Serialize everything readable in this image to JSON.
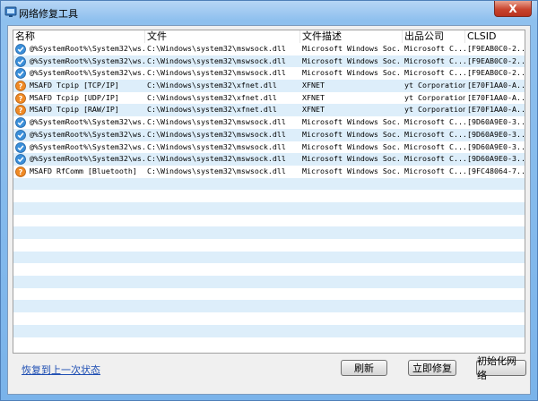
{
  "window": {
    "title": "网络修复工具",
    "close_label": "X"
  },
  "columns": [
    "名称",
    "文件",
    "文件描述",
    "出品公司",
    "CLSID"
  ],
  "rows": [
    {
      "icon": "check",
      "name": "@%SystemRoot%\\System32\\ws...",
      "file": "C:\\Windows\\system32\\mswsock.dll",
      "desc": "Microsoft Windows Soc...",
      "company": "Microsoft C...",
      "clsid": "[F9EAB0C0-2..."
    },
    {
      "icon": "check",
      "name": "@%SystemRoot%\\System32\\ws...",
      "file": "C:\\Windows\\system32\\mswsock.dll",
      "desc": "Microsoft Windows Soc...",
      "company": "Microsoft C...",
      "clsid": "[F9EAB0C0-2..."
    },
    {
      "icon": "check",
      "name": "@%SystemRoot%\\System32\\ws...",
      "file": "C:\\Windows\\system32\\mswsock.dll",
      "desc": "Microsoft Windows Soc...",
      "company": "Microsoft C...",
      "clsid": "[F9EAB0C0-2..."
    },
    {
      "icon": "question",
      "name": "MSAFD Tcpip [TCP/IP]",
      "file": "C:\\Windows\\system32\\xfnet.dll",
      "desc": "XFNET",
      "company": "yt Corporation",
      "clsid": "[E70F1AA0-A..."
    },
    {
      "icon": "question",
      "name": "MSAFD Tcpip [UDP/IP]",
      "file": "C:\\Windows\\system32\\xfnet.dll",
      "desc": "XFNET",
      "company": "yt Corporation",
      "clsid": "[E70F1AA0-A..."
    },
    {
      "icon": "question",
      "name": "MSAFD Tcpip [RAW/IP]",
      "file": "C:\\Windows\\system32\\xfnet.dll",
      "desc": "XFNET",
      "company": "yt Corporation",
      "clsid": "[E70F1AA0-A..."
    },
    {
      "icon": "check",
      "name": "@%SystemRoot%\\System32\\ws...",
      "file": "C:\\Windows\\system32\\mswsock.dll",
      "desc": "Microsoft Windows Soc...",
      "company": "Microsoft C...",
      "clsid": "[9D60A9E0-3..."
    },
    {
      "icon": "check",
      "name": "@%SystemRoot%\\System32\\ws...",
      "file": "C:\\Windows\\system32\\mswsock.dll",
      "desc": "Microsoft Windows Soc...",
      "company": "Microsoft C...",
      "clsid": "[9D60A9E0-3..."
    },
    {
      "icon": "check",
      "name": "@%SystemRoot%\\System32\\ws...",
      "file": "C:\\Windows\\system32\\mswsock.dll",
      "desc": "Microsoft Windows Soc...",
      "company": "Microsoft C...",
      "clsid": "[9D60A9E0-3..."
    },
    {
      "icon": "check",
      "name": "@%SystemRoot%\\System32\\ws...",
      "file": "C:\\Windows\\system32\\mswsock.dll",
      "desc": "Microsoft Windows Soc...",
      "company": "Microsoft C...",
      "clsid": "[9D60A9E0-3..."
    },
    {
      "icon": "question",
      "name": "MSAFD RfComm [Bluetooth]",
      "file": "C:\\Windows\\system32\\mswsock.dll",
      "desc": "Microsoft Windows Soc...",
      "company": "Microsoft C...",
      "clsid": "[9FC48064-7..."
    }
  ],
  "footer": {
    "restore_link": "恢复到上一次状态",
    "refresh_label": "刷新",
    "repair_label": "立即修复",
    "init_label": "初始化网络"
  },
  "colors": {
    "row_stripe": "#ddeefa",
    "check_icon": "#3b8fd9",
    "question_icon": "#f08a24",
    "link": "#1f4fb3"
  }
}
